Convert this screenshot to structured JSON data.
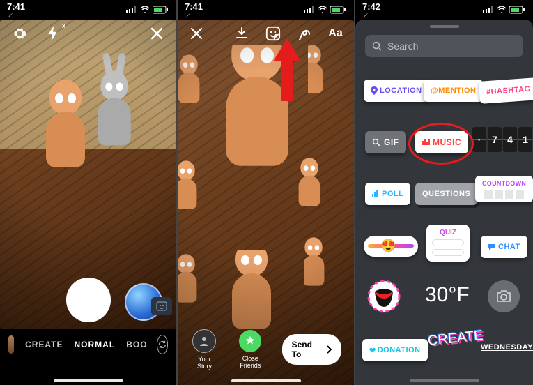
{
  "status": {
    "time_1": "7:41",
    "time_2": "7:41",
    "time_3": "7:42"
  },
  "screen1": {
    "modes": {
      "create": "CREATE",
      "normal": "NORMAL",
      "boomerang": "BOOMERANG"
    },
    "flash_badge": "x"
  },
  "screen2": {
    "toolbar_text": "Aa",
    "your_story": "Your Story",
    "close_friends": "Close Friends",
    "send_to": "Send To"
  },
  "screen3": {
    "search_placeholder": "Search",
    "stickers": {
      "location": "LOCATION",
      "mention": "@MENTION",
      "hashtag": "#HASHTAG",
      "gif": "GIF",
      "music": "MUSIC",
      "time_digits": [
        "·",
        "7",
        "4",
        "1"
      ],
      "poll": "POLL",
      "questions": "QUESTIONS",
      "countdown": "COUNTDOWN",
      "quiz": "QUIZ",
      "chat": "CHAT",
      "temperature": "30°F",
      "donation": "DONATION",
      "create": "CREATE",
      "weekday": "WEDNESDAY"
    }
  },
  "colors": {
    "location": "#6a4df2",
    "mention": "#ff8a00",
    "hashtag": "#ff3d7f",
    "music": "#ff3d3d",
    "poll": "#2fb3ff",
    "chat": "#2f8dff",
    "countdown": "#b74aff",
    "donation": "#19c4e6",
    "quiz_grad_a": "#b44af2",
    "quiz_grad_b": "#ff4da6"
  }
}
